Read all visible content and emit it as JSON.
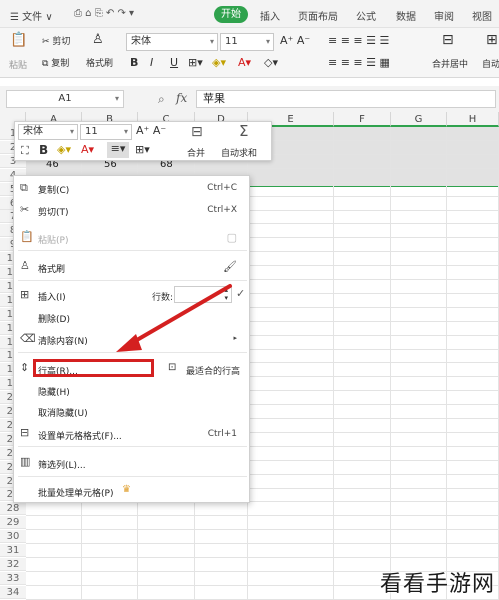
{
  "menubar": {
    "menu_icon": "☰",
    "file": "文件",
    "home": "开始",
    "insert": "插入",
    "layout": "页面布局",
    "formula": "公式",
    "data": "数据",
    "review": "审阅",
    "view": "视图"
  },
  "ribbon": {
    "paste": "粘贴",
    "cut": "剪切",
    "copy": "复制",
    "format_painter": "格式刷",
    "font": "宋体",
    "size": "11",
    "merge": "合并居中",
    "wrap": "自动换行"
  },
  "formula_bar": {
    "cell_ref": "A1",
    "fx": "fx",
    "value": "苹果"
  },
  "columns": [
    "A",
    "B",
    "C",
    "D",
    "E",
    "F",
    "G",
    "H"
  ],
  "rows": [
    "1",
    "2",
    "3",
    "4",
    "5",
    "6",
    "7",
    "8",
    "9",
    "10",
    "11",
    "12",
    "13",
    "14",
    "15",
    "16",
    "17",
    "18",
    "19",
    "20",
    "21",
    "22",
    "23",
    "24",
    "25",
    "26",
    "27",
    "28",
    "29",
    "30",
    "31",
    "32",
    "33",
    "34"
  ],
  "row3_values": [
    "46",
    "56",
    "68"
  ],
  "mini_toolbar": {
    "font": "宋体",
    "size": "11",
    "merge": "合并",
    "autosum": "自动求和"
  },
  "context_menu": {
    "copy": "复制(C)",
    "copy_sc": "Ctrl+C",
    "cut": "剪切(T)",
    "cut_sc": "Ctrl+X",
    "paste": "粘贴(P)",
    "format_painter": "格式刷",
    "insert": "插入(I)",
    "rows_label": "行数:",
    "rows_value": "1",
    "delete": "删除(D)",
    "clear": "清除内容(N)",
    "row_height": "行高(R)...",
    "best_fit": "最适合的行高",
    "hide": "隐藏(H)",
    "unhide": "取消隐藏(U)",
    "format_cells": "设置单元格格式(F)...",
    "format_cells_sc": "Ctrl+1",
    "filter_col": "筛选列(L)...",
    "batch": "批量处理单元格(P)"
  },
  "watermark": "看看手游网",
  "colors": {
    "accent": "#2fa24d",
    "highlight": "#d42020"
  }
}
